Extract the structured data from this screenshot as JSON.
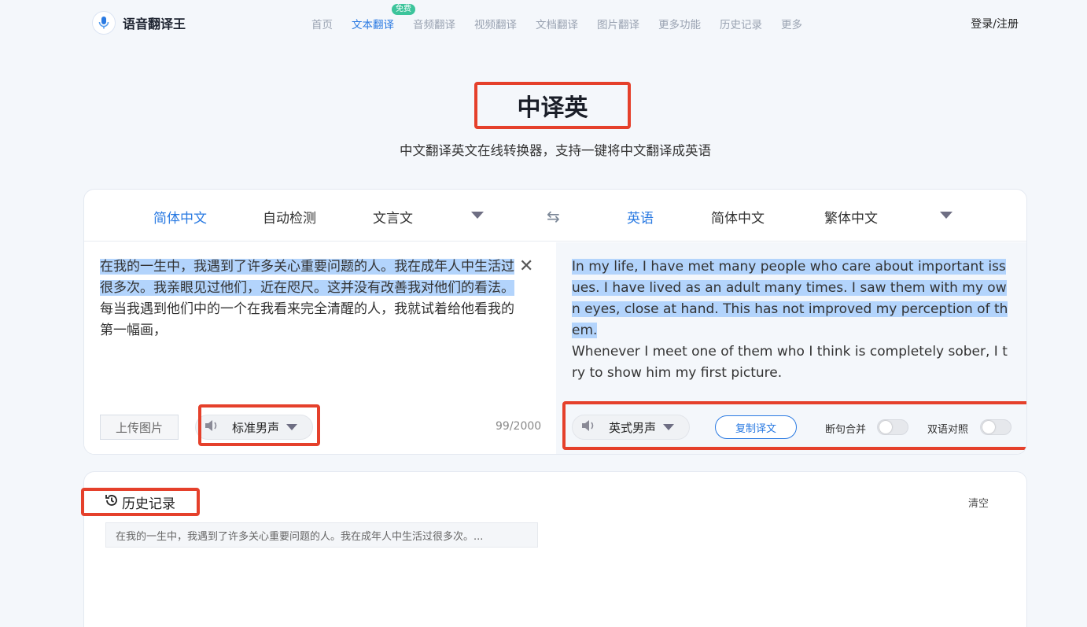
{
  "header": {
    "logo_text": "语音翻译王",
    "nav": [
      "首页",
      "文本翻译",
      "音频翻译",
      "视频翻译",
      "文档翻译",
      "图片翻译",
      "更多功能",
      "历史记录",
      "更多"
    ],
    "nav_active": "文本翻译",
    "nav_badge": "免费",
    "login": "登录/注册"
  },
  "page": {
    "title": "中译英",
    "subtitle": "中文翻译英文在线转换器，支持一键将中文翻译成英语"
  },
  "source_langs": [
    "简体中文",
    "自动检测",
    "文言文"
  ],
  "target_langs": [
    "英语",
    "简体中文",
    "繁体中文"
  ],
  "source": {
    "text_highlighted": "在我的一生中，我遇到了许多关心重要问题的人。我在成年人中生活过很多次。我亲眼见过他们，近在咫尺。这并没有改善我对他们的看法。",
    "text_rest": "每当我遇到他们中的一个在我看来完全清醒的人，我就试着给他看我的第一幅画，",
    "upload_label": "上传图片",
    "voice": "标准男声",
    "counter": "99/2000"
  },
  "target": {
    "text_highlighted": "In my life, I have met many people who care about important issues. I have lived as an adult many times. I saw them with my own eyes, close at hand. This has not improved my perception of them.",
    "text_rest": "Whenever I meet one of them who I think is completely sober, I try to show him my first picture.",
    "voice": "英式男声",
    "copy_label": "复制译文",
    "toggle1_label": "断句合并",
    "toggle2_label": "双语对照"
  },
  "history": {
    "title": "历史记录",
    "clear": "清空",
    "items": [
      "在我的一生中，我遇到了许多关心重要问题的人。我在成年人中生活过很多次。..."
    ]
  },
  "colors": {
    "accent": "#2a7ae2",
    "highlight": "#e5402b",
    "badge": "#3cc49b"
  }
}
